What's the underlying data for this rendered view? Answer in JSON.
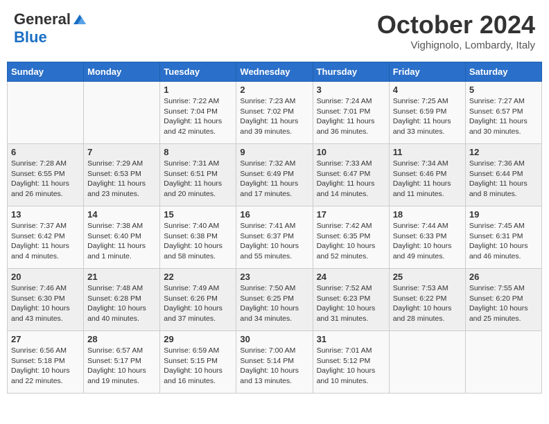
{
  "header": {
    "logo_line1": "General",
    "logo_line2": "Blue",
    "month": "October 2024",
    "location": "Vighignolo, Lombardy, Italy"
  },
  "days_of_week": [
    "Sunday",
    "Monday",
    "Tuesday",
    "Wednesday",
    "Thursday",
    "Friday",
    "Saturday"
  ],
  "weeks": [
    [
      {
        "day": "",
        "sunrise": "",
        "sunset": "",
        "daylight": ""
      },
      {
        "day": "",
        "sunrise": "",
        "sunset": "",
        "daylight": ""
      },
      {
        "day": "1",
        "sunrise": "Sunrise: 7:22 AM",
        "sunset": "Sunset: 7:04 PM",
        "daylight": "Daylight: 11 hours and 42 minutes."
      },
      {
        "day": "2",
        "sunrise": "Sunrise: 7:23 AM",
        "sunset": "Sunset: 7:02 PM",
        "daylight": "Daylight: 11 hours and 39 minutes."
      },
      {
        "day": "3",
        "sunrise": "Sunrise: 7:24 AM",
        "sunset": "Sunset: 7:01 PM",
        "daylight": "Daylight: 11 hours and 36 minutes."
      },
      {
        "day": "4",
        "sunrise": "Sunrise: 7:25 AM",
        "sunset": "Sunset: 6:59 PM",
        "daylight": "Daylight: 11 hours and 33 minutes."
      },
      {
        "day": "5",
        "sunrise": "Sunrise: 7:27 AM",
        "sunset": "Sunset: 6:57 PM",
        "daylight": "Daylight: 11 hours and 30 minutes."
      }
    ],
    [
      {
        "day": "6",
        "sunrise": "Sunrise: 7:28 AM",
        "sunset": "Sunset: 6:55 PM",
        "daylight": "Daylight: 11 hours and 26 minutes."
      },
      {
        "day": "7",
        "sunrise": "Sunrise: 7:29 AM",
        "sunset": "Sunset: 6:53 PM",
        "daylight": "Daylight: 11 hours and 23 minutes."
      },
      {
        "day": "8",
        "sunrise": "Sunrise: 7:31 AM",
        "sunset": "Sunset: 6:51 PM",
        "daylight": "Daylight: 11 hours and 20 minutes."
      },
      {
        "day": "9",
        "sunrise": "Sunrise: 7:32 AM",
        "sunset": "Sunset: 6:49 PM",
        "daylight": "Daylight: 11 hours and 17 minutes."
      },
      {
        "day": "10",
        "sunrise": "Sunrise: 7:33 AM",
        "sunset": "Sunset: 6:47 PM",
        "daylight": "Daylight: 11 hours and 14 minutes."
      },
      {
        "day": "11",
        "sunrise": "Sunrise: 7:34 AM",
        "sunset": "Sunset: 6:46 PM",
        "daylight": "Daylight: 11 hours and 11 minutes."
      },
      {
        "day": "12",
        "sunrise": "Sunrise: 7:36 AM",
        "sunset": "Sunset: 6:44 PM",
        "daylight": "Daylight: 11 hours and 8 minutes."
      }
    ],
    [
      {
        "day": "13",
        "sunrise": "Sunrise: 7:37 AM",
        "sunset": "Sunset: 6:42 PM",
        "daylight": "Daylight: 11 hours and 4 minutes."
      },
      {
        "day": "14",
        "sunrise": "Sunrise: 7:38 AM",
        "sunset": "Sunset: 6:40 PM",
        "daylight": "Daylight: 11 hours and 1 minute."
      },
      {
        "day": "15",
        "sunrise": "Sunrise: 7:40 AM",
        "sunset": "Sunset: 6:38 PM",
        "daylight": "Daylight: 10 hours and 58 minutes."
      },
      {
        "day": "16",
        "sunrise": "Sunrise: 7:41 AM",
        "sunset": "Sunset: 6:37 PM",
        "daylight": "Daylight: 10 hours and 55 minutes."
      },
      {
        "day": "17",
        "sunrise": "Sunrise: 7:42 AM",
        "sunset": "Sunset: 6:35 PM",
        "daylight": "Daylight: 10 hours and 52 minutes."
      },
      {
        "day": "18",
        "sunrise": "Sunrise: 7:44 AM",
        "sunset": "Sunset: 6:33 PM",
        "daylight": "Daylight: 10 hours and 49 minutes."
      },
      {
        "day": "19",
        "sunrise": "Sunrise: 7:45 AM",
        "sunset": "Sunset: 6:31 PM",
        "daylight": "Daylight: 10 hours and 46 minutes."
      }
    ],
    [
      {
        "day": "20",
        "sunrise": "Sunrise: 7:46 AM",
        "sunset": "Sunset: 6:30 PM",
        "daylight": "Daylight: 10 hours and 43 minutes."
      },
      {
        "day": "21",
        "sunrise": "Sunrise: 7:48 AM",
        "sunset": "Sunset: 6:28 PM",
        "daylight": "Daylight: 10 hours and 40 minutes."
      },
      {
        "day": "22",
        "sunrise": "Sunrise: 7:49 AM",
        "sunset": "Sunset: 6:26 PM",
        "daylight": "Daylight: 10 hours and 37 minutes."
      },
      {
        "day": "23",
        "sunrise": "Sunrise: 7:50 AM",
        "sunset": "Sunset: 6:25 PM",
        "daylight": "Daylight: 10 hours and 34 minutes."
      },
      {
        "day": "24",
        "sunrise": "Sunrise: 7:52 AM",
        "sunset": "Sunset: 6:23 PM",
        "daylight": "Daylight: 10 hours and 31 minutes."
      },
      {
        "day": "25",
        "sunrise": "Sunrise: 7:53 AM",
        "sunset": "Sunset: 6:22 PM",
        "daylight": "Daylight: 10 hours and 28 minutes."
      },
      {
        "day": "26",
        "sunrise": "Sunrise: 7:55 AM",
        "sunset": "Sunset: 6:20 PM",
        "daylight": "Daylight: 10 hours and 25 minutes."
      }
    ],
    [
      {
        "day": "27",
        "sunrise": "Sunrise: 6:56 AM",
        "sunset": "Sunset: 5:18 PM",
        "daylight": "Daylight: 10 hours and 22 minutes."
      },
      {
        "day": "28",
        "sunrise": "Sunrise: 6:57 AM",
        "sunset": "Sunset: 5:17 PM",
        "daylight": "Daylight: 10 hours and 19 minutes."
      },
      {
        "day": "29",
        "sunrise": "Sunrise: 6:59 AM",
        "sunset": "Sunset: 5:15 PM",
        "daylight": "Daylight: 10 hours and 16 minutes."
      },
      {
        "day": "30",
        "sunrise": "Sunrise: 7:00 AM",
        "sunset": "Sunset: 5:14 PM",
        "daylight": "Daylight: 10 hours and 13 minutes."
      },
      {
        "day": "31",
        "sunrise": "Sunrise: 7:01 AM",
        "sunset": "Sunset: 5:12 PM",
        "daylight": "Daylight: 10 hours and 10 minutes."
      },
      {
        "day": "",
        "sunrise": "",
        "sunset": "",
        "daylight": ""
      },
      {
        "day": "",
        "sunrise": "",
        "sunset": "",
        "daylight": ""
      }
    ]
  ]
}
